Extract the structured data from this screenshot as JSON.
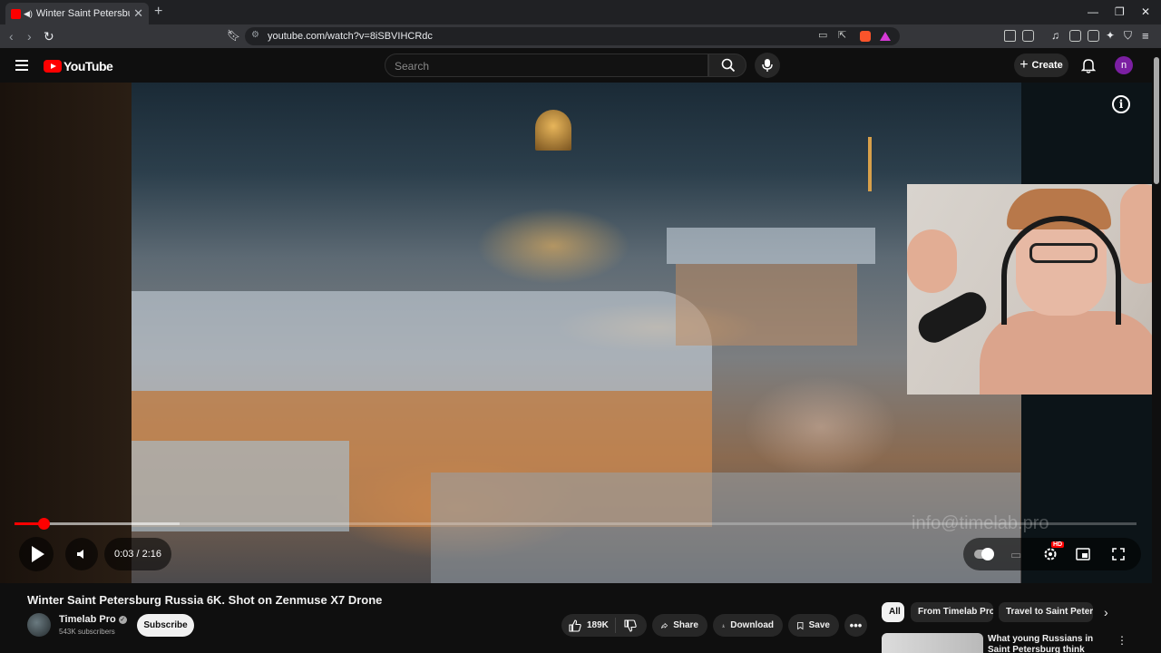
{
  "browser": {
    "tab_title": "Winter Saint Petersburg Russ",
    "url": "youtube.com/watch?v=8iSBVIHCRdc"
  },
  "youtube": {
    "logo_text": "YouTube",
    "search_placeholder": "Search",
    "create_label": "Create",
    "avatar_letter": "n"
  },
  "player": {
    "current_time": "0:03",
    "duration": "2:16",
    "time_display": "0:03 / 2:16",
    "progress_fraction": 0.026,
    "buffer_fraction": 0.147,
    "watermark": "info@timelab.pro",
    "hd_badge": "HD",
    "info_glyph": "i"
  },
  "video": {
    "title": "Winter Saint Petersburg Russia 6K. Shot on Zenmuse X7 Drone",
    "channel": "Timelab Pro",
    "verified_glyph": "✓",
    "subscribers": "543K subscribers",
    "subscribe_label": "Subscribe",
    "likes": "189K",
    "share_label": "Share",
    "download_label": "Download",
    "save_label": "Save"
  },
  "chips": [
    "All",
    "From Timelab Pro",
    "Travel to Saint Petersb"
  ],
  "related": {
    "title": "What young Russians in Saint Petersburg think about Putin?"
  },
  "colors": {
    "accent": "#ff0000",
    "background": "#0f0f0f",
    "chip_bg": "#272727"
  }
}
